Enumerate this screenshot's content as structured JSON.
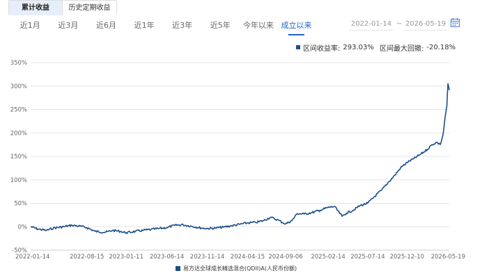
{
  "tabs": [
    {
      "label": "累计收益",
      "active": true
    },
    {
      "label": "历史定期收益",
      "active": false
    }
  ],
  "ranges": [
    "近1月",
    "近3月",
    "近6月",
    "近1年",
    "近3年",
    "近5年",
    "今年以来",
    "成立以来"
  ],
  "active_range": "成立以来",
  "date_range": {
    "start": "2022-01-14",
    "separator": "~",
    "end": "2026-05-19"
  },
  "summary": {
    "return_label": "区间收益率:",
    "return_value": "293.03%",
    "drawdown_label": "区间最大回撤:",
    "drawdown_value": "-20.18%"
  },
  "colors": {
    "series": "#1a4f8a",
    "accent": "#1f62c9",
    "grid": "#e6e6e6"
  },
  "chart_data": {
    "type": "line",
    "legend_position": "bottom",
    "grid": "horizontal",
    "ylim": [
      -50,
      350
    ],
    "yticks": [
      -50,
      0,
      50,
      100,
      150,
      200,
      250,
      300,
      350
    ],
    "ytick_labels": [
      "-50%",
      "0%",
      "50%",
      "100%",
      "150%",
      "200%",
      "250%",
      "300%",
      "350%"
    ],
    "xtick_labels": [
      "2022-01-14",
      "2022-08-15",
      "2023-01-11",
      "2023-06-14",
      "2023-11-14",
      "2024-04-15",
      "2024-09-06",
      "2025-02-14",
      "2025-07-14",
      "2025-12-10",
      "2026-05-19"
    ],
    "series": [
      {
        "name": "易方达全球成长精选混合(QDII)A(人民币份额)",
        "x": [
          "2022-01-14",
          "2022-02-10",
          "2022-03-15",
          "2022-04-10",
          "2022-05-20",
          "2022-06-20",
          "2022-07-20",
          "2022-08-15",
          "2022-09-15",
          "2022-10-25",
          "2022-11-20",
          "2022-12-20",
          "2023-01-11",
          "2023-02-15",
          "2023-03-15",
          "2023-04-15",
          "2023-05-15",
          "2023-06-14",
          "2023-07-15",
          "2023-08-15",
          "2023-09-15",
          "2023-10-25",
          "2023-11-14",
          "2023-12-15",
          "2024-01-15",
          "2024-02-15",
          "2024-03-15",
          "2024-04-15",
          "2024-05-15",
          "2024-06-15",
          "2024-07-10",
          "2024-08-05",
          "2024-08-25",
          "2024-09-06",
          "2024-09-30",
          "2024-10-20",
          "2024-11-15",
          "2024-12-15",
          "2025-01-15",
          "2025-02-14",
          "2025-03-10",
          "2025-04-08",
          "2025-04-25",
          "2025-05-20",
          "2025-06-15",
          "2025-07-14",
          "2025-08-10",
          "2025-09-05",
          "2025-10-01",
          "2025-10-25",
          "2025-11-15",
          "2025-12-10",
          "2026-01-05",
          "2026-02-01",
          "2026-02-25",
          "2026-03-15",
          "2026-04-01",
          "2026-04-15",
          "2026-04-25",
          "2026-05-05",
          "2026-05-10",
          "2026-05-14",
          "2026-05-19"
        ],
        "values": [
          0,
          -5,
          -8,
          -3,
          0,
          3,
          1,
          -2,
          -10,
          -12,
          -8,
          -10,
          -13,
          -10,
          -8,
          -6,
          -4,
          -2,
          3,
          4,
          1,
          -3,
          -4,
          -3,
          -1,
          2,
          5,
          8,
          9,
          13,
          20,
          15,
          9,
          6,
          13,
          28,
          27,
          30,
          35,
          41,
          43,
          22,
          29,
          35,
          45,
          50,
          65,
          78,
          95,
          110,
          125,
          137,
          145,
          155,
          165,
          175,
          180,
          175,
          195,
          240,
          258,
          305,
          291
        ]
      }
    ]
  }
}
